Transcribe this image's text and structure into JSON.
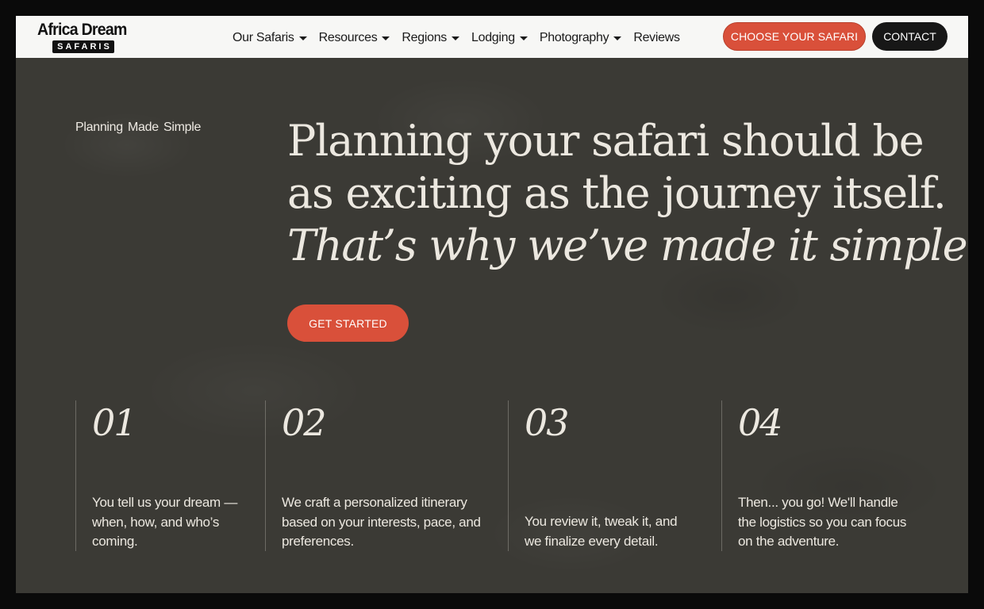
{
  "brand": {
    "name_top": "Africa Dream",
    "name_bottom": "SAFARIS"
  },
  "nav": {
    "items": [
      {
        "label": "Our Safaris",
        "has_dropdown": true
      },
      {
        "label": "Resources",
        "has_dropdown": true
      },
      {
        "label": "Regions",
        "has_dropdown": true
      },
      {
        "label": "Lodging",
        "has_dropdown": true
      },
      {
        "label": "Photography",
        "has_dropdown": true
      },
      {
        "label": "Reviews",
        "has_dropdown": false
      }
    ],
    "choose_label": "CHOOSE YOUR SAFARI",
    "contact_label": "CONTACT"
  },
  "hero": {
    "eyebrow": "Planning  Made Simple",
    "headline_line1": "Planning your safari should be",
    "headline_line2": "as exciting as the journey itself.",
    "headline_line3": "That’s why we’ve made it simple.",
    "cta_label": "GET STARTED"
  },
  "steps": [
    {
      "number": "01",
      "text": "You tell us your dream — when, how, and who’s coming."
    },
    {
      "number": "02",
      "text": "We craft a personalized itinerary based on your interests, pace, and preferences."
    },
    {
      "number": "03",
      "text": "You review it, tweak it, and we finalize every detail."
    },
    {
      "number": "04",
      "text": "Then... you go! We'll handle the logistics so you can focus on the adventure."
    }
  ],
  "colors": {
    "accent": "#d9503a",
    "background": "#3b3a35",
    "header_bg": "#f7f7f5",
    "text_light": "#ece8e0",
    "dark_button": "#171717"
  },
  "icons": {
    "dropdown": "chevron-down-icon"
  }
}
